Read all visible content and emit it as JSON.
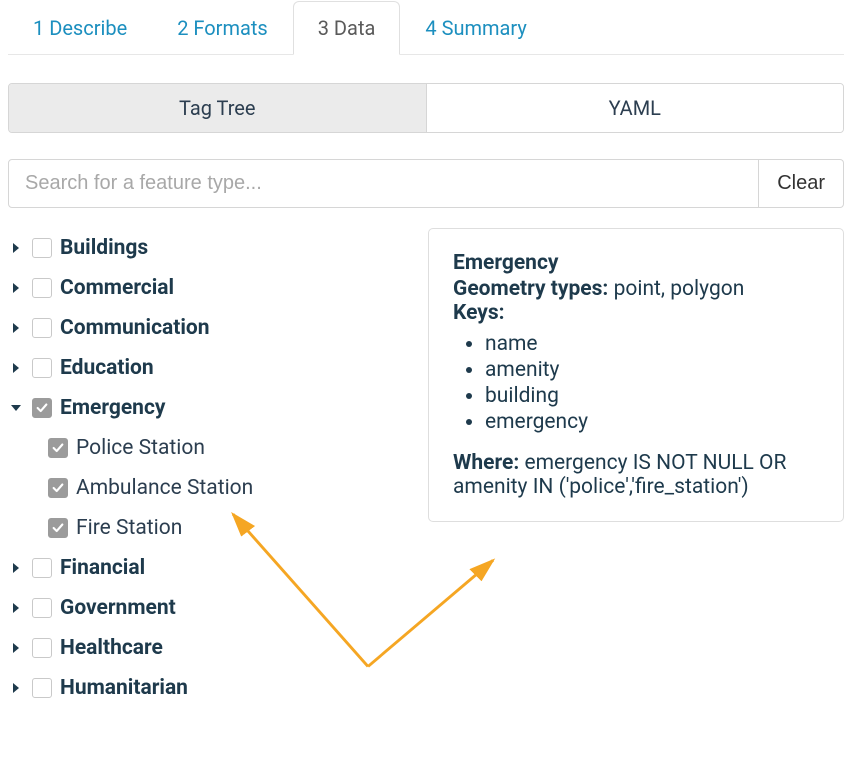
{
  "tabs": [
    {
      "label": "1 Describe",
      "active": false
    },
    {
      "label": "2 Formats",
      "active": false
    },
    {
      "label": "3 Data",
      "active": true
    },
    {
      "label": "4 Summary",
      "active": false
    }
  ],
  "viewToggle": {
    "tree": "Tag Tree",
    "yaml": "YAML",
    "active": "tree"
  },
  "search": {
    "placeholder": "Search for a feature type...",
    "value": "",
    "clear": "Clear"
  },
  "tree": [
    {
      "label": "Buildings",
      "checked": false,
      "expanded": false
    },
    {
      "label": "Commercial",
      "checked": false,
      "expanded": false
    },
    {
      "label": "Communication",
      "checked": false,
      "expanded": false
    },
    {
      "label": "Education",
      "checked": false,
      "expanded": false
    },
    {
      "label": "Emergency",
      "checked": true,
      "expanded": true,
      "children": [
        {
          "label": "Police Station",
          "checked": true
        },
        {
          "label": "Ambulance Station",
          "checked": true
        },
        {
          "label": "Fire Station",
          "checked": true
        }
      ]
    },
    {
      "label": "Financial",
      "checked": false,
      "expanded": false
    },
    {
      "label": "Government",
      "checked": false,
      "expanded": false
    },
    {
      "label": "Healthcare",
      "checked": false,
      "expanded": false
    },
    {
      "label": "Humanitarian",
      "checked": false,
      "expanded": false
    }
  ],
  "details": {
    "title": "Emergency",
    "geom_label": "Geometry types:",
    "geom_value": "point, polygon",
    "keys_label": "Keys:",
    "keys": [
      "name",
      "amenity",
      "building",
      "emergency"
    ],
    "where_label": "Where:",
    "where_value": "emergency IS NOT NULL OR amenity IN ('police','fire_station')"
  },
  "colors": {
    "link": "#1c8fbf",
    "text": "#1e3a4c",
    "arrow": "#f5a623"
  }
}
